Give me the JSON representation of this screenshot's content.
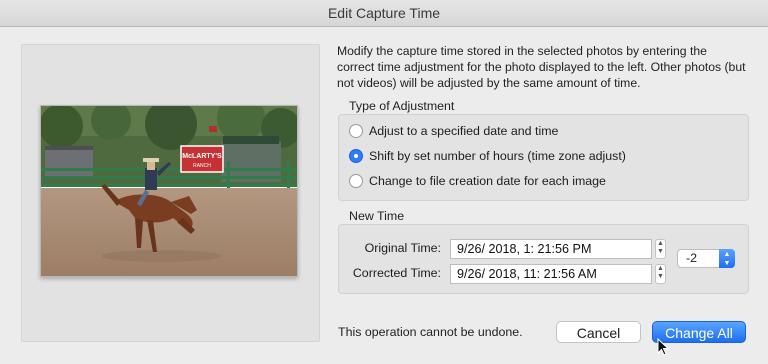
{
  "window": {
    "title": "Edit Capture Time"
  },
  "description": "Modify the capture time stored in the selected photos by entering the correct time adjustment for the photo displayed to the left. Other photos (but not videos) will be adjusted by the same amount of time.",
  "adjustment": {
    "heading": "Type of Adjustment",
    "options": [
      {
        "label": "Adjust to a specified date and time",
        "selected": false
      },
      {
        "label": "Shift by set number of hours (time zone adjust)",
        "selected": true
      },
      {
        "label": "Change to file creation date for each image",
        "selected": false
      }
    ]
  },
  "new_time": {
    "heading": "New Time",
    "original_label": "Original Time:",
    "original_value": "9/26/ 2018,   1: 21:56 PM",
    "corrected_label": "Corrected Time:",
    "corrected_value": "9/26/ 2018, 11: 21:56 AM",
    "hours_shift": "-2"
  },
  "footer": {
    "warning": "This operation cannot be undone.",
    "cancel_label": "Cancel",
    "confirm_label": "Change All"
  },
  "photo": {
    "sign_text": "McLARTY'S",
    "sign_subtext": "RANCH"
  },
  "colors": {
    "accent": "#2b7ef5",
    "window_bg": "#ececec"
  },
  "icons": {
    "stepper": "up-down-chevron-icon",
    "popup": "up-down-chevron-icon",
    "cursor": "arrow-pointer-icon"
  }
}
